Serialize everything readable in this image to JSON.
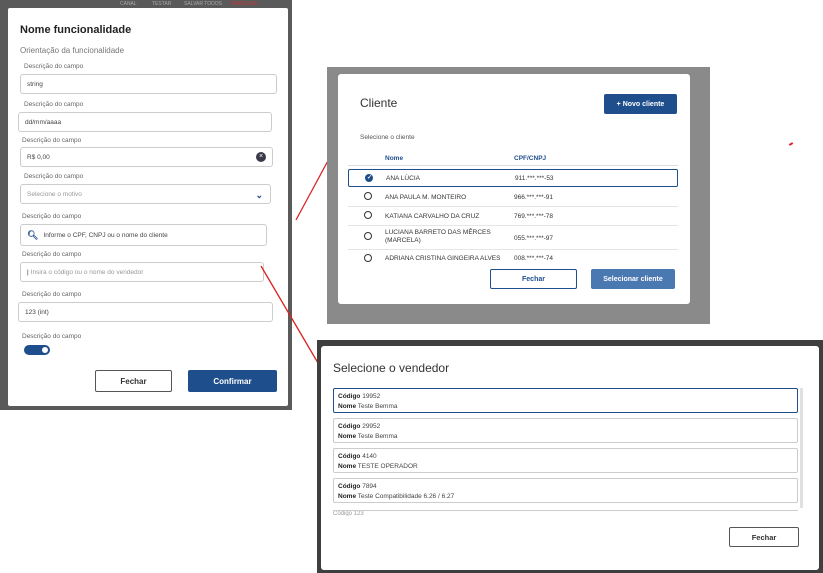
{
  "left_dialog": {
    "topstrip": [
      "CANAL",
      "TESTAR",
      "SALVAR TODOS",
      "CANCELAR"
    ],
    "title": "Nome funcionalidade",
    "subtitle": "Orientação da funcionalidade",
    "fields": [
      {
        "label": "Descrição do campo",
        "value": "string",
        "kind": "text"
      },
      {
        "label": "Descrição do campo",
        "value": "dd/mm/aaaa",
        "kind": "text"
      },
      {
        "label": "Descrição do campo",
        "value": "R$ 0,00",
        "kind": "clearable"
      },
      {
        "label": "Descrição do campo",
        "value": "Selecione o motivo",
        "kind": "select"
      },
      {
        "label": "Descrição do campo",
        "value": "Informe o CPF, CNPJ ou o nome do cliente",
        "kind": "search"
      },
      {
        "label": "Descrição do campo",
        "value": "Insira o código ou o nome do vendedor",
        "kind": "text"
      },
      {
        "label": "Descrição do campo",
        "value": "123 (int)",
        "kind": "text"
      },
      {
        "label": "Descrição do campo",
        "value": "",
        "kind": "toggle"
      }
    ],
    "toggle_on": true,
    "close_label": "Fechar",
    "confirm_label": "Confirmar"
  },
  "cliente_dialog": {
    "title": "Cliente",
    "new_button": "+  Novo cliente",
    "select_label": "Selecione o cliente",
    "columns": [
      "Nome",
      "CPF/CNPJ"
    ],
    "rows": [
      {
        "name": "ANA LÚCIA",
        "cpf": "911.***.***-53",
        "selected": true
      },
      {
        "name": "ANA PAULA M. MONTEIRO",
        "cpf": "966.***.***-91",
        "selected": false
      },
      {
        "name": "KATIANA CARVALHO DA CRUZ",
        "cpf": "769.***.***-78",
        "selected": false
      },
      {
        "name": "LUCIANA BARRETO DAS MÊRCES (MARCELA)",
        "cpf": "055.***.***-97",
        "selected": false
      },
      {
        "name": "ADRIANA CRISTINA GINGEIRA ALVES",
        "cpf": "008.***.***-74",
        "selected": false
      }
    ],
    "close_label": "Fechar",
    "select_button": "Selecionar cliente"
  },
  "vendedor_dialog": {
    "title": "Selecione o vendedor",
    "code_label": "Código",
    "name_label": "Nome",
    "items": [
      {
        "code": "19952",
        "name": "Teste Bemma",
        "selected": true
      },
      {
        "code": "29952",
        "name": "Teste Bemma",
        "selected": false
      },
      {
        "code": "4140",
        "name": "TESTE OPERADOR",
        "selected": false
      },
      {
        "code": "7894",
        "name": "Teste Compatibilidade 6.26 / 6.27",
        "selected": false
      }
    ],
    "partial_item": "Código 123",
    "close_label": "Fechar"
  },
  "colors": {
    "primary": "#1f4e8c",
    "annotation": "#dd2222"
  }
}
